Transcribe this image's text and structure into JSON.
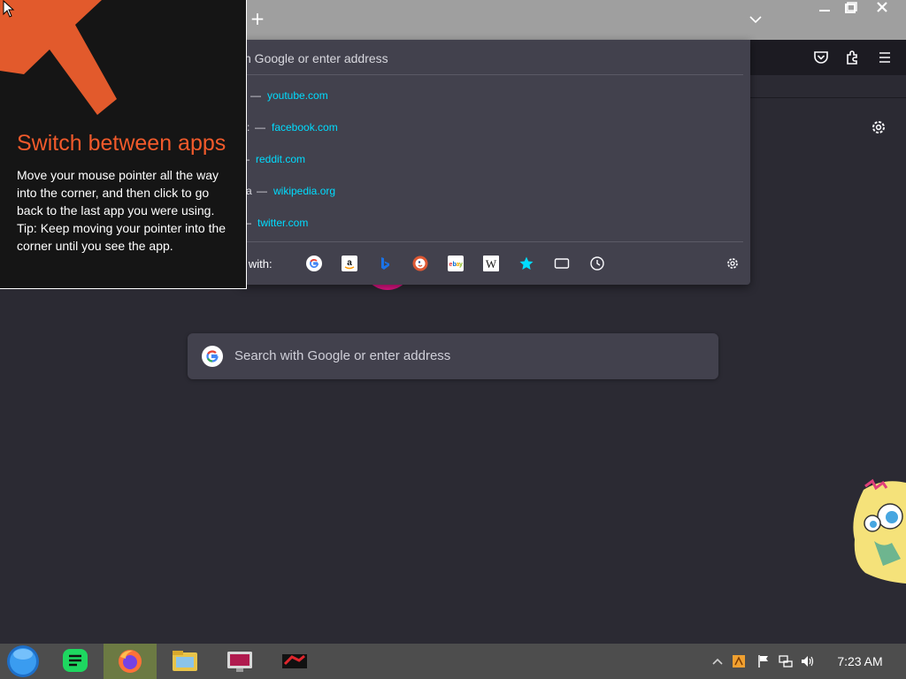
{
  "browser": {
    "new_tab_symbol": "+",
    "toolbar_icons": [
      "pocket-icon",
      "extensions-icon",
      "hamburger-menu-icon"
    ],
    "url_dropdown": {
      "input_text": "h Google or enter address",
      "suggestions": [
        {
          "prefix": "",
          "dash": "—",
          "url": "youtube.com"
        },
        {
          "prefix": ":",
          "dash": "—",
          "url": "facebook.com"
        },
        {
          "prefix": "",
          "dash": "—",
          "url": "reddit.com"
        },
        {
          "prefix": "a",
          "dash": "—",
          "url": "wikipedia.org"
        },
        {
          "prefix": "",
          "dash": "—",
          "url": "twitter.com"
        }
      ],
      "search_with_label": "h with:",
      "engines": [
        "google-icon",
        "amazon-icon",
        "bing-icon",
        "duckduckgo-icon",
        "ebay-icon",
        "wikipedia-icon",
        "bookmarks-star-icon",
        "tabs-icon",
        "history-icon"
      ]
    },
    "new_tab": {
      "search_placeholder": "Search with Google or enter address"
    }
  },
  "tip": {
    "title": "Switch between apps",
    "body_line1": "Move your mouse pointer all the way into the corner, and then click to go back to the last app you were using.",
    "body_line2": "Tip: Keep moving your pointer into the corner until you see the app."
  },
  "taskbar": {
    "apps": [
      "spotify-icon",
      "firefox-icon",
      "file-explorer-icon",
      "display-app-icon",
      "game-app-icon"
    ],
    "tray": [
      "show-hidden-icons-arrow",
      "tray-app-icon",
      "flag-icon",
      "network-icon",
      "volume-icon"
    ],
    "clock": "7:23 AM"
  },
  "colors": {
    "accent_orange": "#f25a2b",
    "link_cyan": "#00ddff",
    "panel_bg": "#42414d",
    "page_bg": "#2b2a33",
    "taskbar_bg": "#4d4d4d",
    "firefox_active_bg": "#6c7a43"
  }
}
